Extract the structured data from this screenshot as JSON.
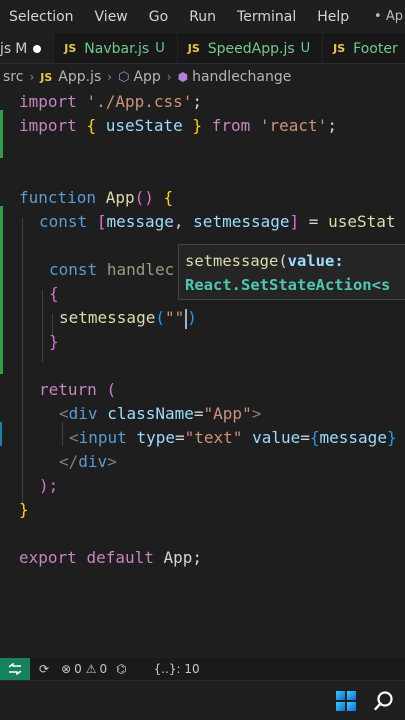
{
  "menubar": {
    "items": [
      "Selection",
      "View",
      "Go",
      "Run",
      "Terminal",
      "Help"
    ],
    "extra": "• Ap"
  },
  "tabs": [
    {
      "icon": "js",
      "name": "M",
      "status": "",
      "active": true
    },
    {
      "icon": "JS",
      "name": "Navbar.js",
      "status": "U"
    },
    {
      "icon": "JS",
      "name": "SpeedApp.js",
      "status": "U"
    },
    {
      "icon": "JS",
      "name": "Footer",
      "status": ""
    }
  ],
  "breadcrumb": {
    "folder": "src",
    "file_icon": "JS",
    "file": "App.js",
    "component": "App",
    "function": "handlechange"
  },
  "code": {
    "l1_kw": "import",
    "l1_str": "'./App.css'",
    "l1_end": ";",
    "l2_kw": "import",
    "l2_open": "{",
    "l2_name": "useState",
    "l2_close": "}",
    "l2_from": "from",
    "l2_str": "'react'",
    "l2_end": ";",
    "l4_kw": "function",
    "l4_name": "App",
    "l4_paren": "()",
    "l4_brace": "{",
    "l5_kw": "const",
    "l5_open": "[",
    "l5_a": "message",
    "l5_comma": ",",
    "l5_b": "setmessage",
    "l5_close": "]",
    "l5_eq": "=",
    "l5_call": "useStat",
    "l7_kw": "const",
    "l7_name": "handlec",
    "l8_brace": "{",
    "l9_call": "setmessage",
    "l9_open": "(",
    "l9_str": "\"\"",
    "l9_close": ")",
    "l10_brace": "}",
    "l12_kw": "return",
    "l12_paren": "(",
    "l13_lt": "<",
    "l13_tag": "div",
    "l13_attr": "className",
    "l13_eq": "=",
    "l13_val": "\"App\"",
    "l13_gt": ">",
    "l14_lt": "<",
    "l14_tag": "input",
    "l14_attr1": "type",
    "l14_eq1": "=",
    "l14_val1": "\"text\"",
    "l14_attr2": "value",
    "l14_eq2": "=",
    "l14_brace": "{",
    "l14_var": "message",
    "l14_brace2": "}",
    "l15_lt": "</",
    "l15_tag": "div",
    "l15_gt": ">",
    "l16_close": ");",
    "l17_brace": "}",
    "l19_kw1": "export",
    "l19_kw2": "default",
    "l19_name": "App",
    "l19_end": ";"
  },
  "tooltip": {
    "fn": "setmessage",
    "open": "(",
    "param": "value:",
    "type": "React.SetStateAction<s"
  },
  "status": {
    "errors": "0",
    "warnings": "0",
    "info": "{..}: 10"
  },
  "colors": {
    "accent_green": "#16825d",
    "editor_bg": "#1e1e1e",
    "keyword_blue": "#569cd6",
    "keyword_purple": "#c586c0",
    "string": "#ce9178",
    "function": "#dcdcaa",
    "variable": "#9cdcfe"
  }
}
